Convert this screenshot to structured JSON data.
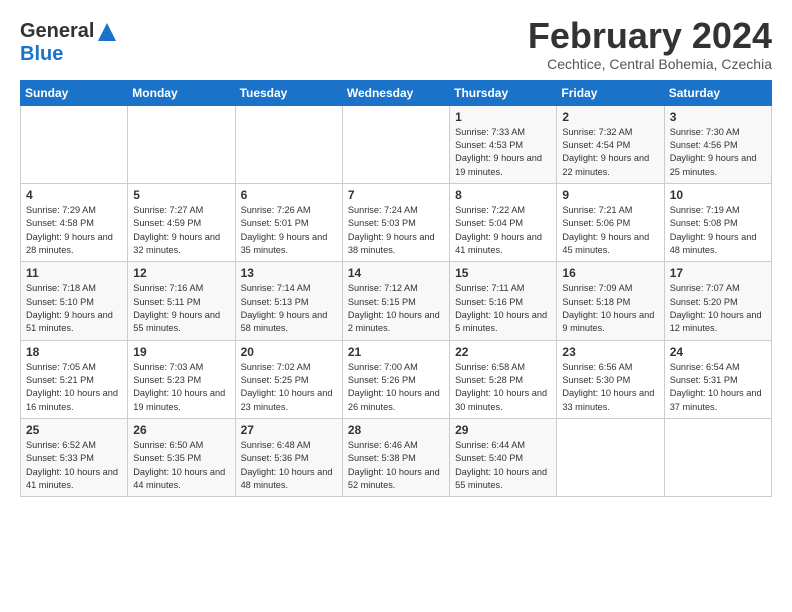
{
  "logo": {
    "line1": "General",
    "line2": "Blue"
  },
  "title": "February 2024",
  "location": "Cechtice, Central Bohemia, Czechia",
  "days_of_week": [
    "Sunday",
    "Monday",
    "Tuesday",
    "Wednesday",
    "Thursday",
    "Friday",
    "Saturday"
  ],
  "weeks": [
    [
      null,
      null,
      null,
      null,
      {
        "day": "1",
        "sunrise": "7:33 AM",
        "sunset": "4:53 PM",
        "daylight": "9 hours and 19 minutes."
      },
      {
        "day": "2",
        "sunrise": "7:32 AM",
        "sunset": "4:54 PM",
        "daylight": "9 hours and 22 minutes."
      },
      {
        "day": "3",
        "sunrise": "7:30 AM",
        "sunset": "4:56 PM",
        "daylight": "9 hours and 25 minutes."
      }
    ],
    [
      {
        "day": "4",
        "sunrise": "7:29 AM",
        "sunset": "4:58 PM",
        "daylight": "9 hours and 28 minutes."
      },
      {
        "day": "5",
        "sunrise": "7:27 AM",
        "sunset": "4:59 PM",
        "daylight": "9 hours and 32 minutes."
      },
      {
        "day": "6",
        "sunrise": "7:26 AM",
        "sunset": "5:01 PM",
        "daylight": "9 hours and 35 minutes."
      },
      {
        "day": "7",
        "sunrise": "7:24 AM",
        "sunset": "5:03 PM",
        "daylight": "9 hours and 38 minutes."
      },
      {
        "day": "8",
        "sunrise": "7:22 AM",
        "sunset": "5:04 PM",
        "daylight": "9 hours and 41 minutes."
      },
      {
        "day": "9",
        "sunrise": "7:21 AM",
        "sunset": "5:06 PM",
        "daylight": "9 hours and 45 minutes."
      },
      {
        "day": "10",
        "sunrise": "7:19 AM",
        "sunset": "5:08 PM",
        "daylight": "9 hours and 48 minutes."
      }
    ],
    [
      {
        "day": "11",
        "sunrise": "7:18 AM",
        "sunset": "5:10 PM",
        "daylight": "9 hours and 51 minutes."
      },
      {
        "day": "12",
        "sunrise": "7:16 AM",
        "sunset": "5:11 PM",
        "daylight": "9 hours and 55 minutes."
      },
      {
        "day": "13",
        "sunrise": "7:14 AM",
        "sunset": "5:13 PM",
        "daylight": "9 hours and 58 minutes."
      },
      {
        "day": "14",
        "sunrise": "7:12 AM",
        "sunset": "5:15 PM",
        "daylight": "10 hours and 2 minutes."
      },
      {
        "day": "15",
        "sunrise": "7:11 AM",
        "sunset": "5:16 PM",
        "daylight": "10 hours and 5 minutes."
      },
      {
        "day": "16",
        "sunrise": "7:09 AM",
        "sunset": "5:18 PM",
        "daylight": "10 hours and 9 minutes."
      },
      {
        "day": "17",
        "sunrise": "7:07 AM",
        "sunset": "5:20 PM",
        "daylight": "10 hours and 12 minutes."
      }
    ],
    [
      {
        "day": "18",
        "sunrise": "7:05 AM",
        "sunset": "5:21 PM",
        "daylight": "10 hours and 16 minutes."
      },
      {
        "day": "19",
        "sunrise": "7:03 AM",
        "sunset": "5:23 PM",
        "daylight": "10 hours and 19 minutes."
      },
      {
        "day": "20",
        "sunrise": "7:02 AM",
        "sunset": "5:25 PM",
        "daylight": "10 hours and 23 minutes."
      },
      {
        "day": "21",
        "sunrise": "7:00 AM",
        "sunset": "5:26 PM",
        "daylight": "10 hours and 26 minutes."
      },
      {
        "day": "22",
        "sunrise": "6:58 AM",
        "sunset": "5:28 PM",
        "daylight": "10 hours and 30 minutes."
      },
      {
        "day": "23",
        "sunrise": "6:56 AM",
        "sunset": "5:30 PM",
        "daylight": "10 hours and 33 minutes."
      },
      {
        "day": "24",
        "sunrise": "6:54 AM",
        "sunset": "5:31 PM",
        "daylight": "10 hours and 37 minutes."
      }
    ],
    [
      {
        "day": "25",
        "sunrise": "6:52 AM",
        "sunset": "5:33 PM",
        "daylight": "10 hours and 41 minutes."
      },
      {
        "day": "26",
        "sunrise": "6:50 AM",
        "sunset": "5:35 PM",
        "daylight": "10 hours and 44 minutes."
      },
      {
        "day": "27",
        "sunrise": "6:48 AM",
        "sunset": "5:36 PM",
        "daylight": "10 hours and 48 minutes."
      },
      {
        "day": "28",
        "sunrise": "6:46 AM",
        "sunset": "5:38 PM",
        "daylight": "10 hours and 52 minutes."
      },
      {
        "day": "29",
        "sunrise": "6:44 AM",
        "sunset": "5:40 PM",
        "daylight": "10 hours and 55 minutes."
      },
      null,
      null
    ]
  ]
}
